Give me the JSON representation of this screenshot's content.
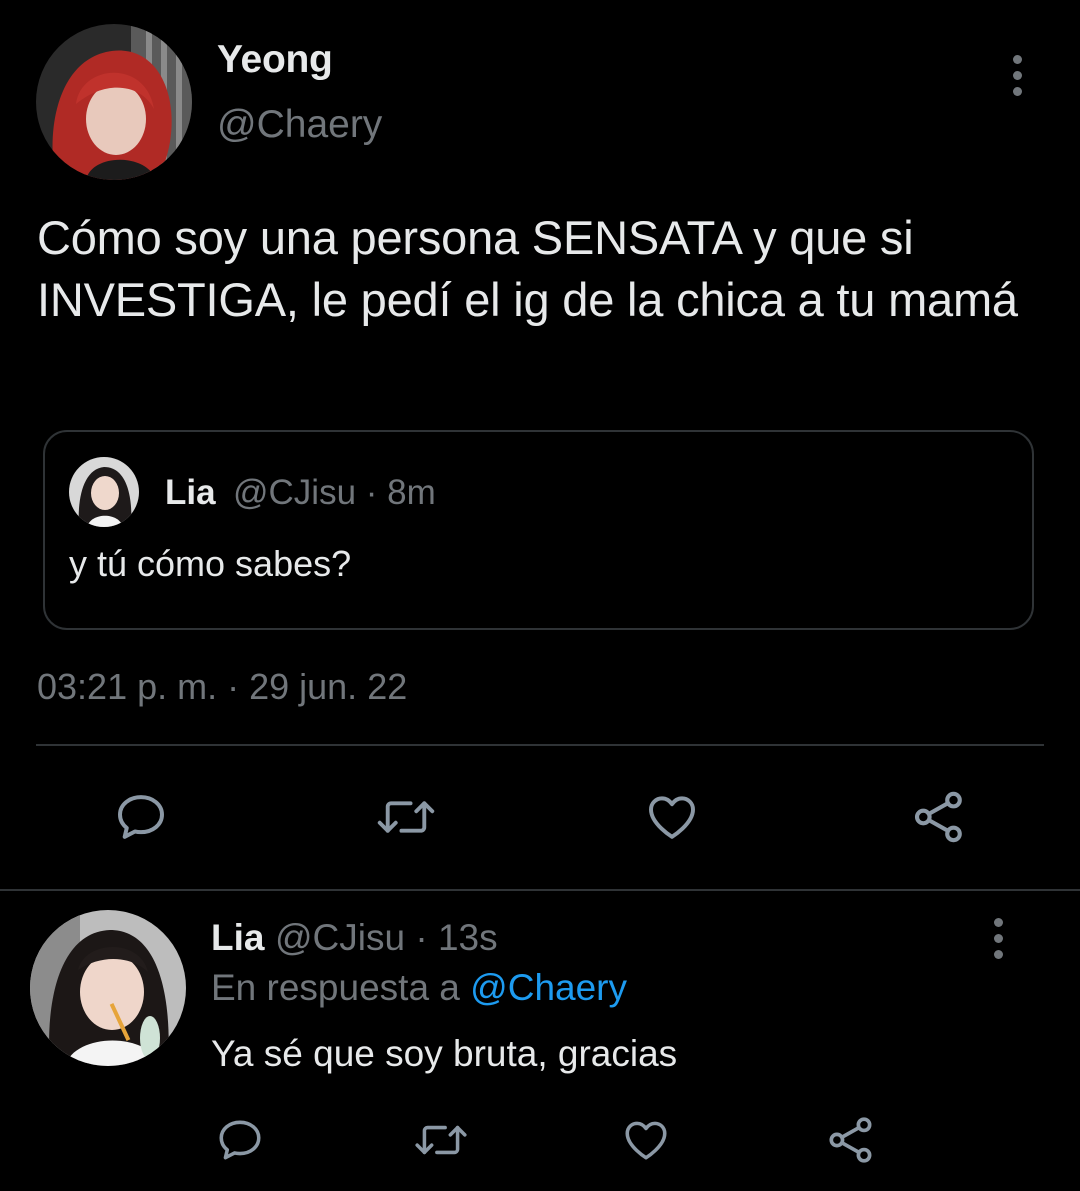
{
  "main_tweet": {
    "display_name": "Yeong",
    "handle": "@Chaery",
    "text": "Cómo soy una persona SENSATA y que si INVESTIGA, le pedí el ig de la chica a tu mamá",
    "timestamp": "03:21 p. m. · 29 jun. 22",
    "menu_icon": "more-vertical-icon",
    "quoted_tweet": {
      "display_name": "Lia",
      "meta": "@CJisu · 8m",
      "text": "y tú cómo sabes?"
    },
    "actions": [
      "reply-icon",
      "retweet-icon",
      "like-icon",
      "share-icon"
    ]
  },
  "reply_tweet": {
    "display_name": "Lia",
    "meta": "@CJisu · 13s",
    "reply_prefix": "En respuesta a ",
    "reply_to": "@Chaery",
    "text": "Ya sé que soy bruta, gracias",
    "menu_icon": "more-vertical-icon",
    "actions": [
      "reply-icon",
      "retweet-icon",
      "like-icon",
      "share-icon"
    ]
  },
  "colors": {
    "background": "#000000",
    "primary_text": "#e7e9ea",
    "secondary_text": "#71767b",
    "divider": "#2f3336",
    "link": "#1d9bf0",
    "icon": "#8b98a5"
  }
}
